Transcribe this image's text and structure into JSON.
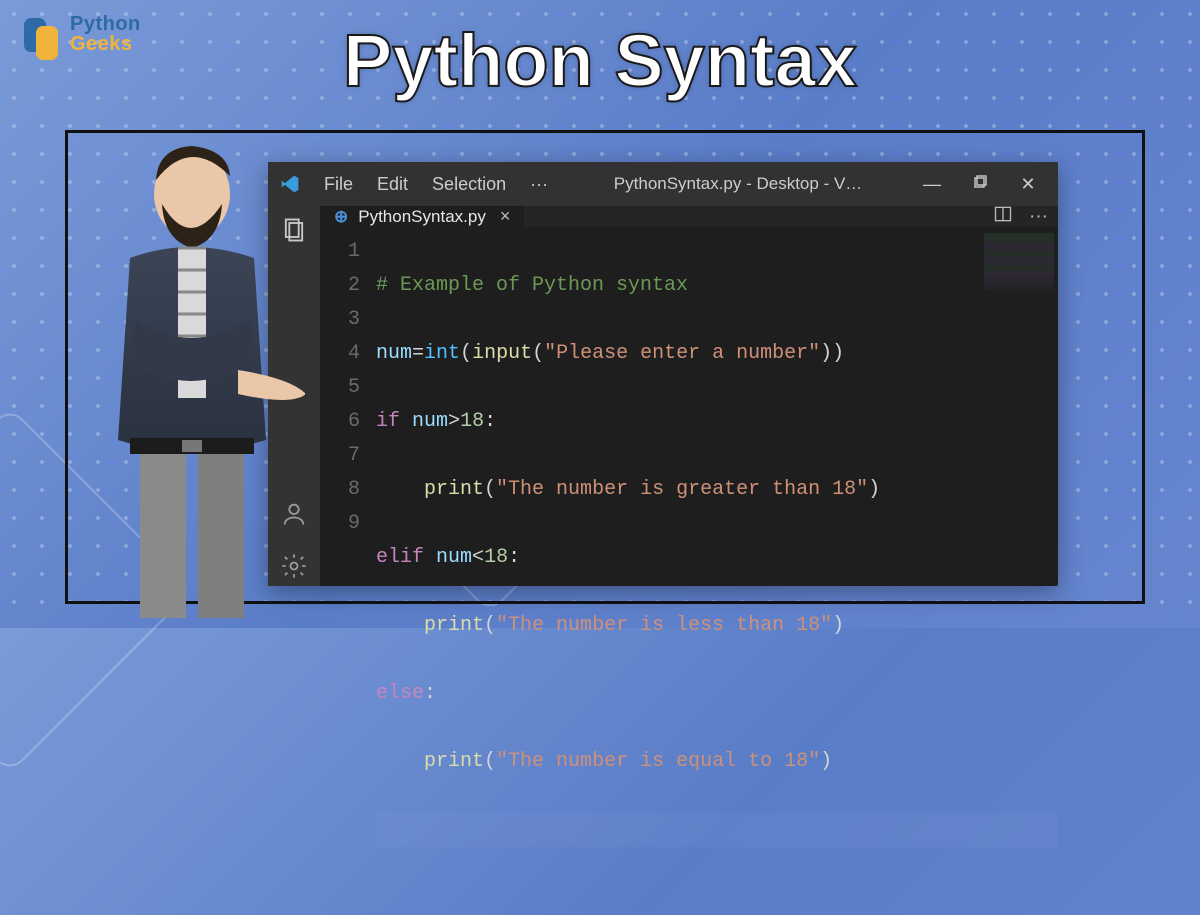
{
  "brand": {
    "top": "Python",
    "bottom": "Geeks"
  },
  "page_title": "Python Syntax",
  "vscode": {
    "menu": {
      "file": "File",
      "edit": "Edit",
      "selection": "Selection",
      "more": "···"
    },
    "window_title": "PythonSyntax.py - Desktop - V…",
    "tab": {
      "filename": "PythonSyntax.py"
    },
    "line_numbers": [
      "1",
      "2",
      "3",
      "4",
      "5",
      "6",
      "7",
      "8",
      "9"
    ],
    "code": {
      "l1_comment": "# Example of Python syntax",
      "l2_var": "num",
      "l2_func_int": "int",
      "l2_func_input": "input",
      "l2_str": "\"Please enter a number\"",
      "l3_kw_if": "if",
      "l3_var": "num",
      "l3_op": ">",
      "l3_num": "18",
      "l4_print": "print",
      "l4_str": "\"The number is greater than 18\"",
      "l5_kw_elif": "elif",
      "l5_var": "num",
      "l5_op": "<",
      "l5_num": "18",
      "l6_print": "print",
      "l6_str": "\"The number is less than 18\"",
      "l7_kw_else": "else",
      "l8_print": "print",
      "l8_str": "\"The number is equal to 18\""
    }
  }
}
